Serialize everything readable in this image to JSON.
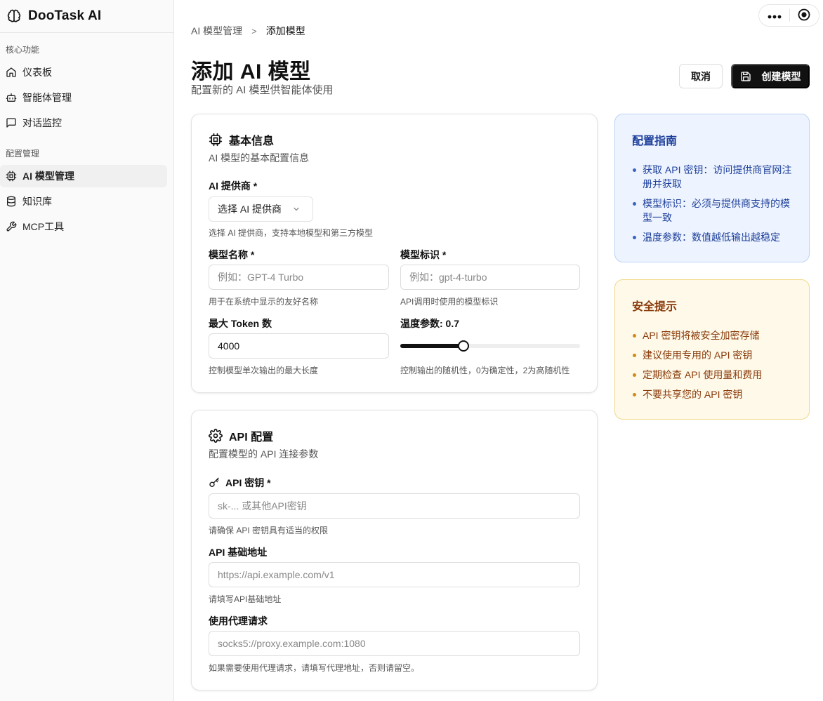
{
  "app": {
    "name": "DooTask AI"
  },
  "sidebar": {
    "group_core": "核心功能",
    "group_config": "配置管理",
    "items": [
      {
        "label": "仪表板",
        "icon": "home-icon"
      },
      {
        "label": "智能体管理",
        "icon": "bot-icon"
      },
      {
        "label": "对话监控",
        "icon": "message-square-icon"
      },
      {
        "label": "AI 模型管理",
        "icon": "cpu-icon",
        "active": true
      },
      {
        "label": "知识库",
        "icon": "database-icon"
      },
      {
        "label": "MCP工具",
        "icon": "wrench-icon"
      }
    ]
  },
  "breadcrumb": {
    "parent": "AI 模型管理",
    "separator": ">",
    "current": "添加模型"
  },
  "page": {
    "title": "添加 AI 模型",
    "subtitle": "配置新的 AI 模型供智能体使用",
    "cancel_label": "取消",
    "create_label": "创建模型"
  },
  "basic": {
    "title": "基本信息",
    "desc": "AI 模型的基本配置信息",
    "provider_label": "AI 提供商 *",
    "provider_placeholder": "选择 AI 提供商",
    "provider_hint": "选择 AI 提供商，支持本地模型和第三方模型",
    "name_label": "模型名称 *",
    "name_placeholder": "例如：GPT-4 Turbo",
    "name_hint": "用于在系统中显示的友好名称",
    "id_label": "模型标识 *",
    "id_placeholder": "例如：gpt-4-turbo",
    "id_hint": "API调用时使用的模型标识",
    "tokens_label": "最大 Token 数",
    "tokens_value": "4000",
    "tokens_hint": "控制模型单次输出的最大长度",
    "temp_label": "温度参数: 0.7",
    "temp_value": 0.7,
    "temp_max": 2,
    "temp_hint": "控制输出的随机性，0为确定性，2为高随机性"
  },
  "api": {
    "title": "API 配置",
    "desc": "配置模型的 API 连接参数",
    "key_label": "API 密钥 *",
    "key_placeholder": "sk-... 或其他API密钥",
    "key_hint": "请确保 API 密钥具有适当的权限",
    "base_label": "API 基础地址",
    "base_placeholder": "https://api.example.com/v1",
    "base_hint": "请填写API基础地址",
    "proxy_label": "使用代理请求",
    "proxy_placeholder": "socks5://proxy.example.com:1080",
    "proxy_hint": "如果需要使用代理请求，请填写代理地址，否则请留空。"
  },
  "guide": {
    "title": "配置指南",
    "items": [
      "获取 API 密钥：访问提供商官网注册并获取",
      "模型标识：必须与提供商支持的模型一致",
      "温度参数：数值越低输出越稳定"
    ]
  },
  "safety": {
    "title": "安全提示",
    "items": [
      "API 密钥将被安全加密存储",
      "建议使用专用的 API 密钥",
      "定期检查 API 使用量和费用",
      "不要共享您的 API 密钥"
    ]
  },
  "colors": {
    "primary": "#111111",
    "guide_bg": "#eef4ff",
    "guide_text": "#1d3f9a",
    "safety_bg": "#fef9e8",
    "safety_text": "#8a3b0b"
  }
}
